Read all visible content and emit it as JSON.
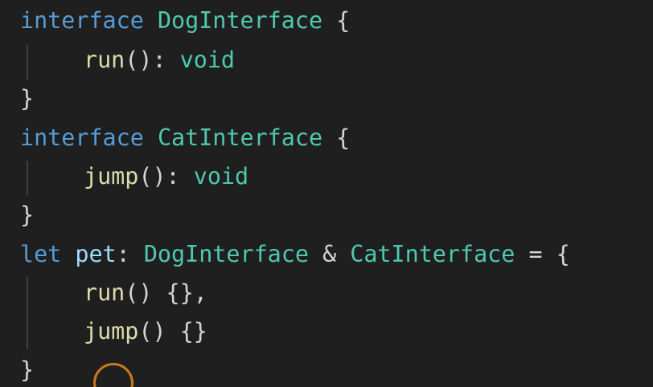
{
  "code": {
    "line1": {
      "kw": "interface",
      "name": "DogInterface",
      "brace": "{"
    },
    "line2": {
      "method": "run",
      "sig": "():",
      "ret": "void"
    },
    "line3": {
      "brace": "}"
    },
    "line4": {
      "kw": "interface",
      "name": "CatInterface",
      "brace": "{"
    },
    "line5": {
      "method": "jump",
      "sig": "():",
      "ret": "void"
    },
    "line6": {
      "brace": "}"
    },
    "line7": {
      "kw": "let",
      "var": "pet",
      "colon": ":",
      "type1": "DogInterface",
      "amp": "&",
      "type2": "CatInterface",
      "eq": "=",
      "brace": "{"
    },
    "line8": {
      "method": "run",
      "rest": "() {},"
    },
    "line9": {
      "method": "jump",
      "rest": "() {}"
    },
    "line10": {
      "brace": "}"
    }
  },
  "colors": {
    "background": "#1f1f1f",
    "keyword": "#569cd6",
    "type": "#4ec9b0",
    "function": "#dcdcaa",
    "variable": "#9cdcfe",
    "punctuation": "#d4d4d4",
    "cursor_ring": "#c8781c"
  },
  "icons": [
    "mouse-cursor-ring-icon"
  ]
}
